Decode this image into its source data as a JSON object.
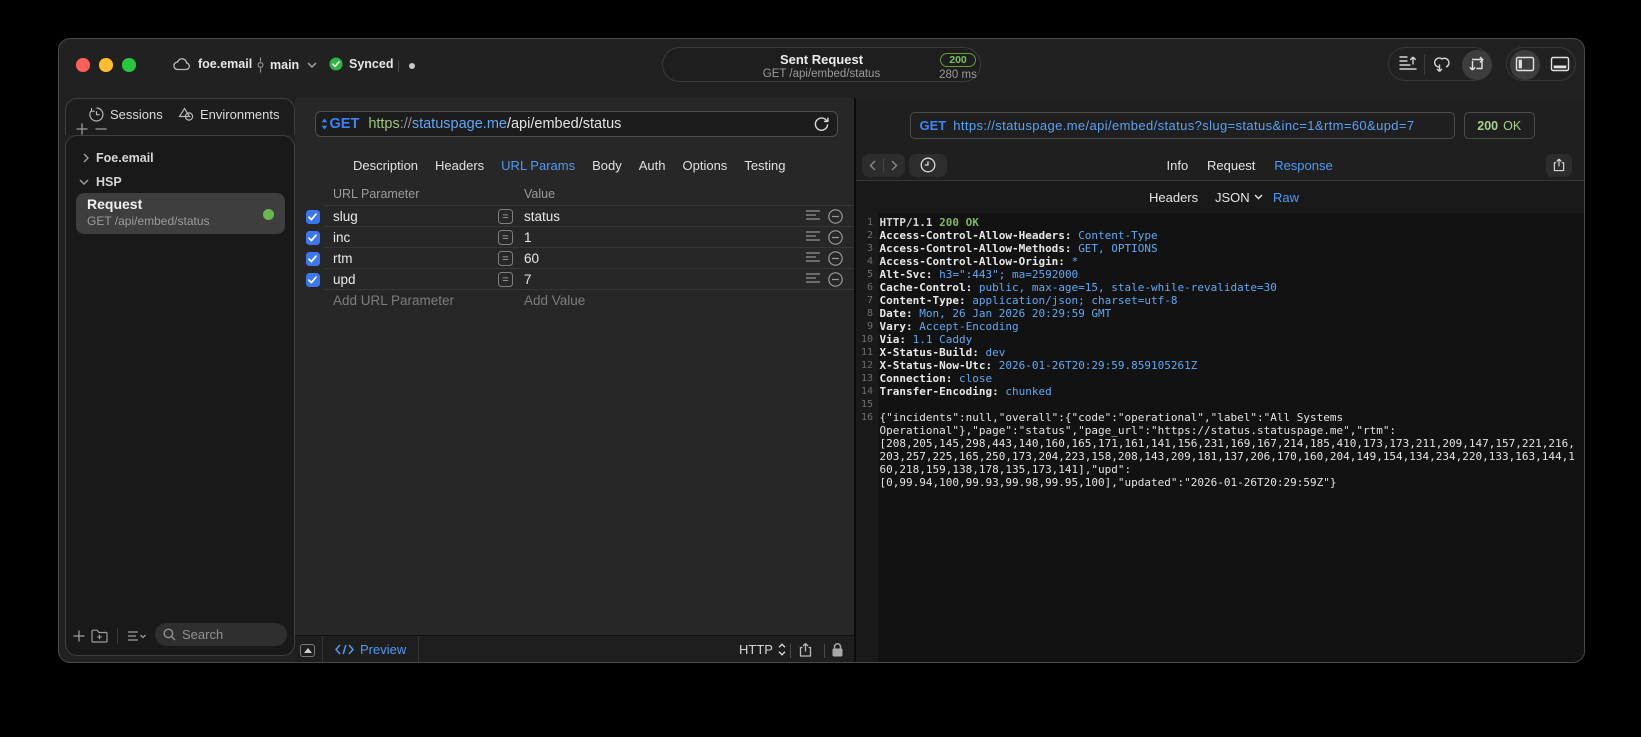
{
  "colors": {
    "accent_blue": "#4d9bf5",
    "method_blue": "#3b82f7",
    "value_blue": "#5ea9f3",
    "scheme_green": "#a3c47c",
    "status_green": "#7cba57",
    "status_badge_green": "#a5d28c",
    "checkbox_blue": "#3b77f0",
    "request_dot_green": "#69b84e",
    "traffic_red": "#ff5f57",
    "traffic_yellow": "#febc2e",
    "traffic_green": "#28c840"
  },
  "titlebar": {
    "project": "foe.email",
    "branch": "main",
    "sync_label": "Synced",
    "sent": {
      "title": "Sent Request",
      "subtitle": "GET /api/embed/status",
      "status_code": "200",
      "duration": "280 ms"
    }
  },
  "sidebar": {
    "tabs": [
      {
        "label": "Sessions"
      },
      {
        "label": "Environments"
      }
    ],
    "tree": [
      {
        "label": "Foe.email"
      },
      {
        "label": "HSP"
      }
    ],
    "selected_request": {
      "title": "Request",
      "subtitle": "GET /api/embed/status"
    },
    "search_placeholder": "Search"
  },
  "request": {
    "method": "GET",
    "url_scheme": "https",
    "url_sep": "://",
    "url_host": "statuspage.me",
    "url_path": "/api/embed/status",
    "tabs": [
      "Description",
      "Headers",
      "URL Params",
      "Body",
      "Auth",
      "Options",
      "Testing"
    ],
    "active_tab": "URL Params",
    "params": {
      "col_name": "URL Parameter",
      "col_value": "Value",
      "rows": [
        {
          "name": "slug",
          "value": "status",
          "checked": true
        },
        {
          "name": "inc",
          "value": "1",
          "checked": true
        },
        {
          "name": "rtm",
          "value": "60",
          "checked": true
        },
        {
          "name": "upd",
          "value": "7",
          "checked": true
        }
      ],
      "add_name": "Add URL Parameter",
      "add_value": "Add Value"
    },
    "bottom": {
      "preview": "Preview",
      "protocol": "HTTP"
    }
  },
  "response": {
    "method": "GET",
    "url": "https://statuspage.me/api/embed/status?slug=status&inc=1&rtm=60&upd=7",
    "status_code": "200",
    "status_text": "OK",
    "tabs": [
      "Info",
      "Request",
      "Response"
    ],
    "active_tab": "Response",
    "views": [
      "Headers",
      "JSON",
      "Raw"
    ],
    "active_view": "Raw",
    "lines": [
      {
        "n": "1",
        "proto": "HTTP/1.1 ",
        "status": "200 OK"
      },
      {
        "n": "2",
        "name": "Access-Control-Allow-Headers: ",
        "value": "Content-Type"
      },
      {
        "n": "3",
        "name": "Access-Control-Allow-Methods: ",
        "value": "GET, OPTIONS"
      },
      {
        "n": "4",
        "name": "Access-Control-Allow-Origin: ",
        "value": "*"
      },
      {
        "n": "5",
        "name": "Alt-Svc: ",
        "value": "h3=\":443\"; ma=2592000"
      },
      {
        "n": "6",
        "name": "Cache-Control: ",
        "value": "public, max-age=15, stale-while-revalidate=30"
      },
      {
        "n": "7",
        "name": "Content-Type: ",
        "value": "application/json; charset=utf-8"
      },
      {
        "n": "8",
        "name": "Date: ",
        "value": "Mon, 26 Jan 2026 20:29:59 GMT"
      },
      {
        "n": "9",
        "name": "Vary: ",
        "value": "Accept-Encoding"
      },
      {
        "n": "10",
        "name": "Via: ",
        "value": "1.1 Caddy"
      },
      {
        "n": "11",
        "name": "X-Status-Build: ",
        "value": "dev"
      },
      {
        "n": "12",
        "name": "X-Status-Now-Utc: ",
        "value": "2026-01-26T20:29:59.859105261Z"
      },
      {
        "n": "13",
        "name": "Connection: ",
        "value": "close"
      },
      {
        "n": "14",
        "name": "Transfer-Encoding: ",
        "value": "chunked"
      },
      {
        "n": "15"
      },
      {
        "n": "16",
        "body": "{\"incidents\":null,\"overall\":{\"code\":\"operational\",\"label\":\"All Systems"
      },
      {
        "n": "",
        "body": "Operational\"},\"page\":\"status\",\"page_url\":\"https://status.statuspage.me\",\"rtm\":"
      },
      {
        "n": "",
        "body": "[208,205,145,298,443,140,160,165,171,161,141,156,231,169,167,214,185,410,173,173,211,209,147,157,221,216,"
      },
      {
        "n": "",
        "body": "203,257,225,165,250,173,204,223,158,208,143,209,181,137,206,170,160,204,149,154,134,234,220,133,163,144,1"
      },
      {
        "n": "",
        "body": "60,218,159,138,178,135,173,141],\"upd\":"
      },
      {
        "n": "",
        "body": "[0,99.94,100,99.93,99.98,99.95,100],\"updated\":\"2026-01-26T20:29:59Z\"}"
      }
    ]
  }
}
